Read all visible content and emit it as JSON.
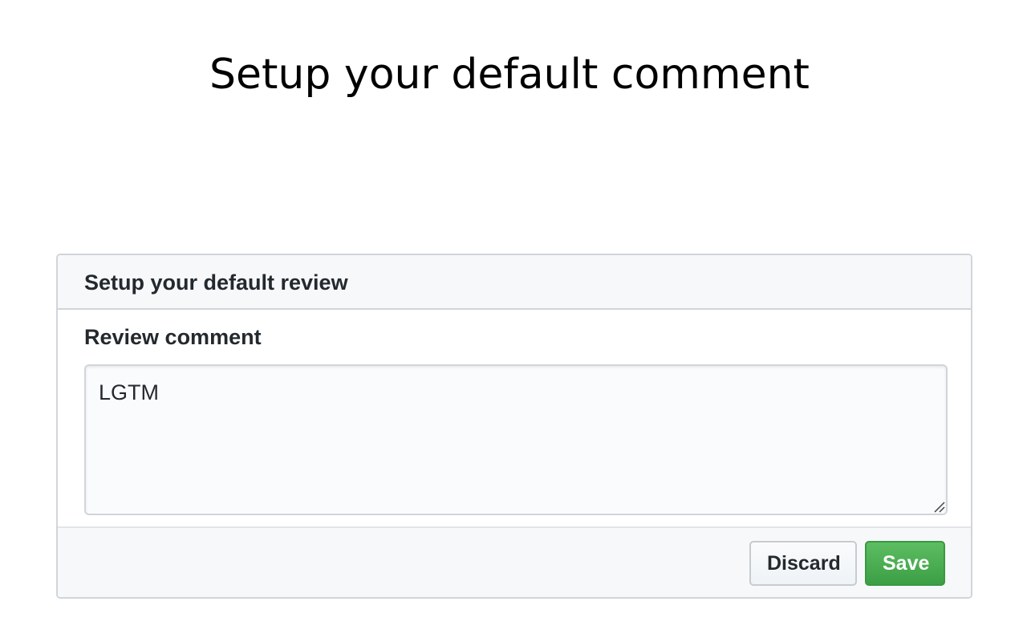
{
  "page": {
    "title": "Setup your default comment"
  },
  "panel": {
    "header_title": "Setup your default review",
    "field_label": "Review comment",
    "comment_value": "LGTM",
    "discard_label": "Discard",
    "save_label": "Save"
  },
  "colors": {
    "header_bg": "#f6f8fa",
    "border": "#d1d5da",
    "text": "#24292e",
    "save_bg": "#4caf50",
    "save_text": "#ffffff"
  },
  "icons": {
    "resize": "resize-grip-icon"
  }
}
